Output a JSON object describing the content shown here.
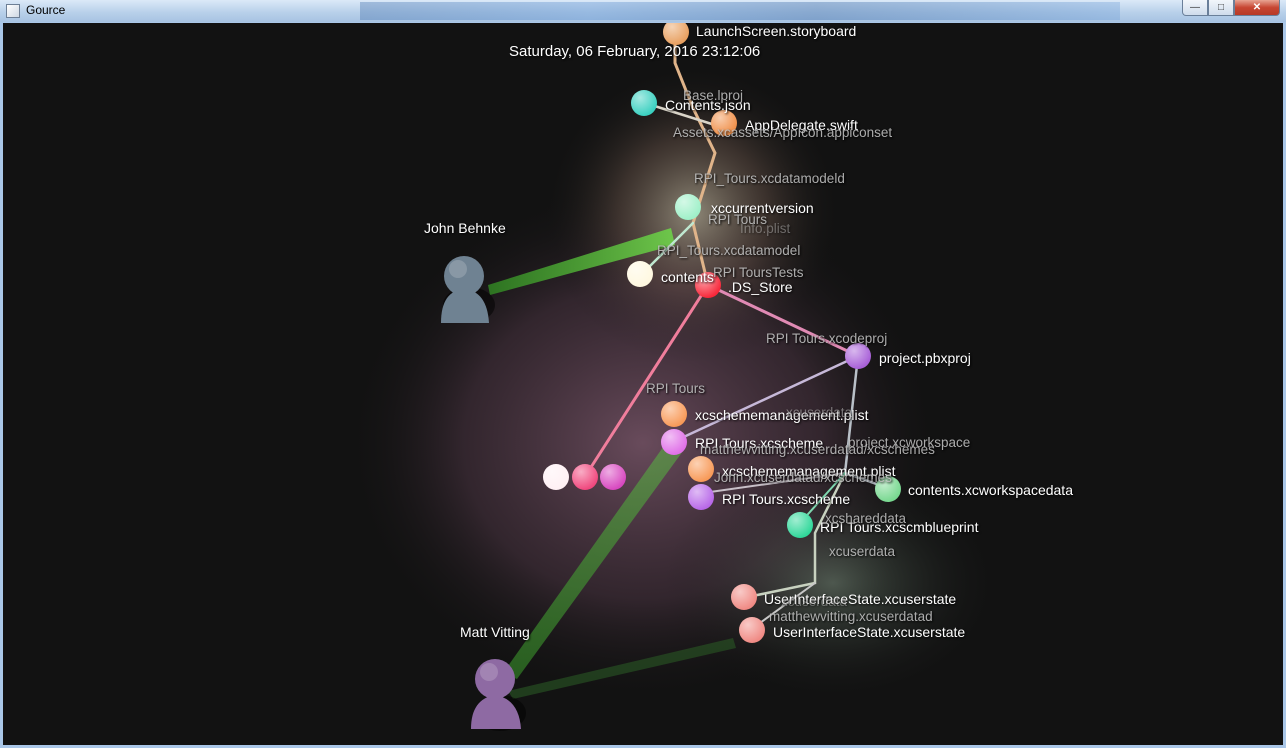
{
  "window": {
    "title": "Gource",
    "close_glyph": "✕",
    "max_glyph": "□",
    "min_glyph": "—"
  },
  "timestamp": "Saturday, 06 February, 2016 23:12:06",
  "users": [
    {
      "name": "John Behnke",
      "color": "#6f8292"
    },
    {
      "name": "Matt Vitting",
      "color": "#8e6aa3"
    }
  ],
  "file_labels": [
    "LaunchScreen.storyboard",
    "Contents.json",
    "AppDelegate.swift",
    "xccurrentversion",
    "contents",
    ".DS_Store",
    "project.pbxproj",
    "xcschememanagement.plist",
    "RPI Tours.xcscheme",
    "xcschememanagement.plist",
    "RPI Tours.xcscheme",
    "contents.xcworkspacedata",
    "RPI Tours.xcscmblueprint",
    "UserInterfaceState.xcuserstate",
    "UserInterfaceState.xcuserstate"
  ],
  "dir_labels": [
    "Base.lproj",
    "Assets.xcassets/AppIcon.appiconset",
    "RPI_Tours.xcdatamodeld",
    "RPI Tours",
    "Info.plist",
    "RPI_Tours.xcdatamodel",
    "RPI ToursTests",
    "RPI Tours.xcodeproj",
    "RPI Tours",
    "xcuserdata",
    "project.xcworkspace",
    "matthewvitting.xcuserdatad/xcschemes",
    "John.xcuserdatad/xcschemes",
    "xcshareddata",
    "xcuserdata",
    "xcuserdata",
    "matthewvitting.xcuserdatad"
  ]
}
